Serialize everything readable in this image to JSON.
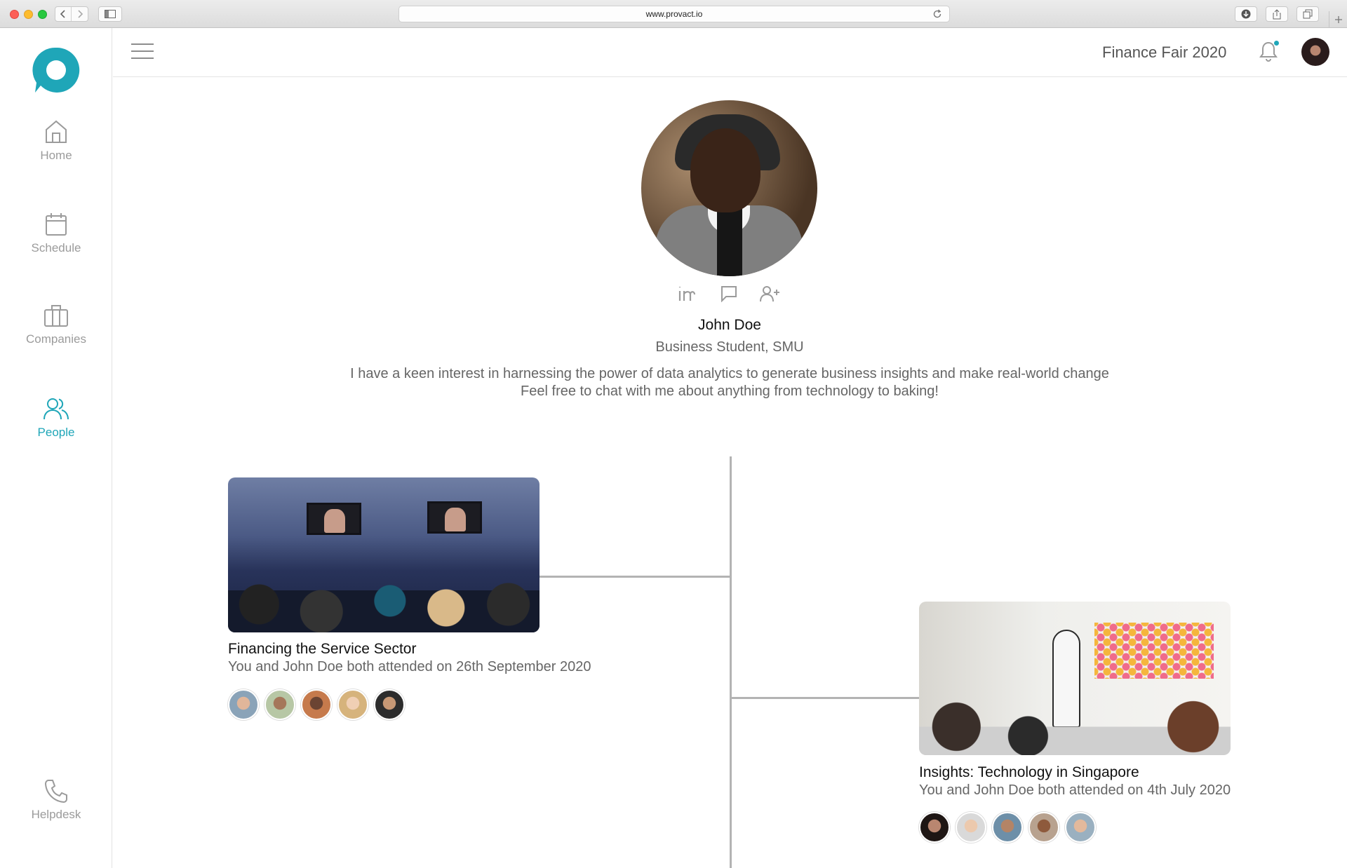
{
  "browser": {
    "url": "www.provact.io"
  },
  "sidebar": {
    "items": [
      {
        "label": "Home",
        "icon": "home-icon"
      },
      {
        "label": "Schedule",
        "icon": "calendar-icon"
      },
      {
        "label": "Companies",
        "icon": "briefcase-icon"
      },
      {
        "label": "People",
        "icon": "people-icon",
        "active": true
      },
      {
        "label": "Helpdesk",
        "icon": "phone-icon"
      }
    ]
  },
  "header": {
    "event_name": "Finance Fair 2020"
  },
  "profile": {
    "name": "John Doe",
    "title": "Business Student, SMU",
    "bio_line1": "I have a keen interest in harnessing the power of data analytics to generate business insights and make real-world change",
    "bio_line2": "Feel free to chat with me about anything from technology to baking!"
  },
  "events": [
    {
      "title": "Financing the Service Sector",
      "subtitle": "You and John Doe both attended on 26th September 2020",
      "attendee_count": 5
    },
    {
      "title": "Insights: Technology in Singapore",
      "subtitle": "You and John Doe both attended on 4th July 2020",
      "attendee_count": 5
    }
  ],
  "colors": {
    "accent": "#1fa6b8",
    "muted_text": "#9b9b9b",
    "timeline": "#b3b3b3"
  }
}
